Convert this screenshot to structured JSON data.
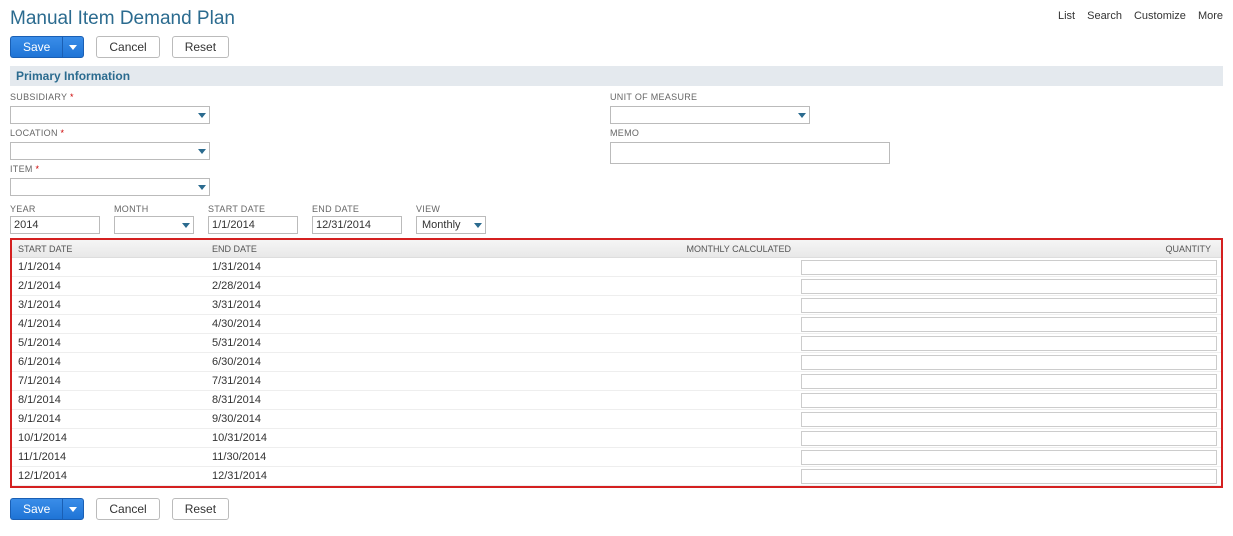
{
  "header": {
    "title": "Manual Item Demand Plan",
    "links": [
      "List",
      "Search",
      "Customize",
      "More"
    ]
  },
  "buttons": {
    "save": "Save",
    "cancel": "Cancel",
    "reset": "Reset"
  },
  "section": {
    "primary": "Primary Information"
  },
  "fields": {
    "subsidiary_label": "SUBSIDIARY",
    "location_label": "LOCATION",
    "item_label": "ITEM",
    "uom_label": "UNIT OF MEASURE",
    "memo_label": "MEMO"
  },
  "filters": {
    "year_label": "YEAR",
    "year_value": "2014",
    "month_label": "MONTH",
    "month_value": "",
    "startdate_label": "START DATE",
    "startdate_value": "1/1/2014",
    "enddate_label": "END DATE",
    "enddate_value": "12/31/2014",
    "view_label": "VIEW",
    "view_value": "Monthly"
  },
  "grid": {
    "headers": {
      "start": "START DATE",
      "end": "END DATE",
      "mcalc": "MONTHLY CALCULATED",
      "qty": "QUANTITY"
    },
    "rows": [
      {
        "start": "1/1/2014",
        "end": "1/31/2014",
        "qty": ""
      },
      {
        "start": "2/1/2014",
        "end": "2/28/2014",
        "qty": ""
      },
      {
        "start": "3/1/2014",
        "end": "3/31/2014",
        "qty": ""
      },
      {
        "start": "4/1/2014",
        "end": "4/30/2014",
        "qty": ""
      },
      {
        "start": "5/1/2014",
        "end": "5/31/2014",
        "qty": ""
      },
      {
        "start": "6/1/2014",
        "end": "6/30/2014",
        "qty": ""
      },
      {
        "start": "7/1/2014",
        "end": "7/31/2014",
        "qty": ""
      },
      {
        "start": "8/1/2014",
        "end": "8/31/2014",
        "qty": ""
      },
      {
        "start": "9/1/2014",
        "end": "9/30/2014",
        "qty": ""
      },
      {
        "start": "10/1/2014",
        "end": "10/31/2014",
        "qty": ""
      },
      {
        "start": "11/1/2014",
        "end": "11/30/2014",
        "qty": ""
      },
      {
        "start": "12/1/2014",
        "end": "12/31/2014",
        "qty": ""
      }
    ]
  }
}
